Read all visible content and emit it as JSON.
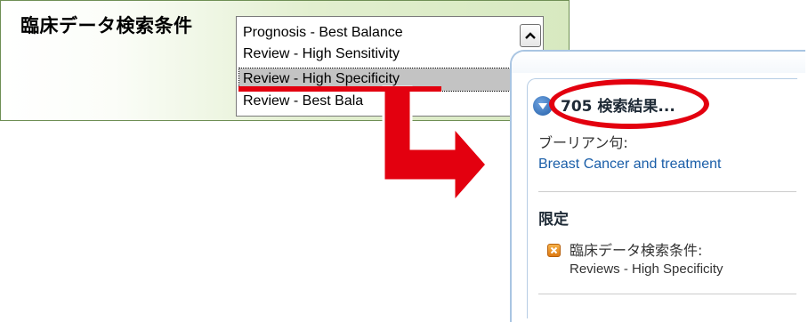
{
  "criteria": {
    "label": "臨床データ検索条件",
    "options": [
      "Prognosis - Best Balance",
      "Review - High Sensitivity",
      "Review - High Specificity",
      "Review - Best Bala"
    ],
    "selected_option": "Review - High Specificity",
    "scrollbar_icon": "chevron-up-icon"
  },
  "results": {
    "count_label": "705 検索結果...",
    "collapse_icon": "collapse-circle-icon",
    "query_label": "ブーリアン句:",
    "query_text": "Breast Cancer and treatment",
    "limits_heading": "限定",
    "limit_remove_icon": "remove-x-icon",
    "limit_name": "臨床データ検索条件:",
    "limit_value": "Reviews - High Specificity"
  },
  "colors": {
    "highlight": "#e3000f",
    "panel_green": "#d7e9c0",
    "link_blue": "#1a5ea8",
    "panel_border_blue": "#a9c5e2",
    "selected_gray": "#c3c3c3"
  }
}
